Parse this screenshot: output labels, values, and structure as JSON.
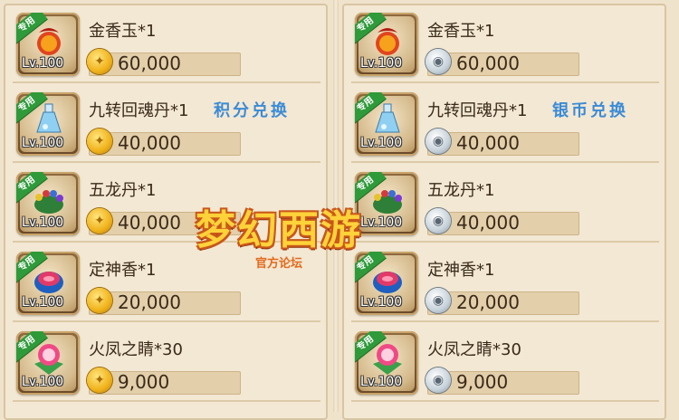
{
  "tag_label": "专用",
  "level_label": "Lv.100",
  "watermark": {
    "title": "梦幻西游",
    "subtitle": "官方论坛"
  },
  "left": {
    "exchange_label": "积分兑换",
    "currency_icon": "gold-coin-icon",
    "items": [
      {
        "name": "金香玉*1",
        "price": "60,000",
        "icon": "jin-xiang-yu-icon",
        "show_exchange": false
      },
      {
        "name": "九转回魂丹*1",
        "price": "40,000",
        "icon": "jiu-zhuan-hui-hun-dan-icon",
        "show_exchange": true
      },
      {
        "name": "五龙丹*1",
        "price": "40,000",
        "icon": "wu-long-dan-icon",
        "show_exchange": false
      },
      {
        "name": "定神香*1",
        "price": "20,000",
        "icon": "ding-shen-xiang-icon",
        "show_exchange": false
      },
      {
        "name": "火凤之睛*30",
        "price": "9,000",
        "icon": "huo-feng-zhi-jing-icon",
        "show_exchange": false
      }
    ]
  },
  "right": {
    "exchange_label": "银币兑换",
    "currency_icon": "silver-coin-icon",
    "items": [
      {
        "name": "金香玉*1",
        "price": "60,000",
        "icon": "jin-xiang-yu-icon",
        "show_exchange": false
      },
      {
        "name": "九转回魂丹*1",
        "price": "40,000",
        "icon": "jiu-zhuan-hui-hun-dan-icon",
        "show_exchange": true
      },
      {
        "name": "五龙丹*1",
        "price": "40,000",
        "icon": "wu-long-dan-icon",
        "show_exchange": false
      },
      {
        "name": "定神香*1",
        "price": "20,000",
        "icon": "ding-shen-xiang-icon",
        "show_exchange": false
      },
      {
        "name": "火凤之睛*30",
        "price": "9,000",
        "icon": "huo-feng-zhi-jing-icon",
        "show_exchange": false
      }
    ]
  },
  "colors": {
    "tag_green": "#2f9a3a",
    "exchange_blue": "#3b8bd6",
    "gold_coin": "#f0b21a",
    "silver_coin": "#c7d2da"
  }
}
